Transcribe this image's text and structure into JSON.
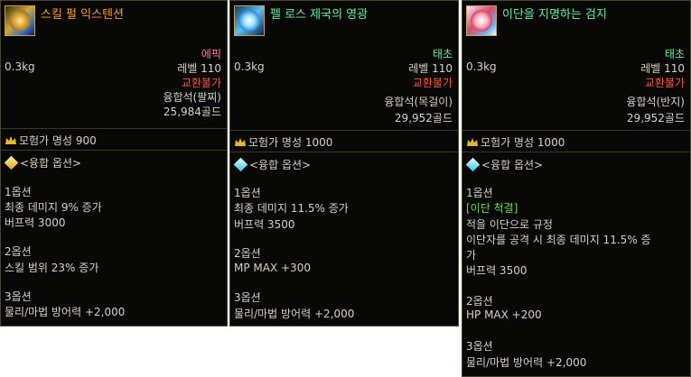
{
  "tooltips": [
    {
      "title": "스킬 펄 익스텐션",
      "rarity": "에픽",
      "weight": "0.3kg",
      "level": "레벨 110",
      "trade": "교환불가",
      "stone": "융합석(팔찌)",
      "price": "25,984골드",
      "fame": "모험가 명성 900",
      "fusion_header": "<융합 옵션>",
      "opt1_label": "1옵션",
      "opt1_line1": "최종 데미지 9% 증가",
      "opt1_line2": "버프력 3000",
      "opt2_label": "2옵션",
      "opt2_line1": "스킬 범위 23% 증가",
      "opt3_label": "3옵션",
      "opt3_line1": "물리/마법 방어력 +2,000"
    },
    {
      "title": "펠 로스 제국의 영광",
      "rarity": "태초",
      "weight": "0.3kg",
      "level": "레벨 110",
      "trade": "교환불가",
      "stone": "융합석(목걸이)",
      "price": "29,952골드",
      "fame": "모험가 명성 1000",
      "fusion_header": "<융합 옵션>",
      "opt1_label": "1옵션",
      "opt1_line1": "최종 데미지 11.5% 증가",
      "opt1_line2": "버프력 3500",
      "opt2_label": "2옵션",
      "opt2_line1": "MP MAX +300",
      "opt3_label": "3옵션",
      "opt3_line1": "물리/마법 방어력 +2,000"
    },
    {
      "title": "이단을 지명하는 검지",
      "rarity": "태초",
      "weight": "0.3kg",
      "level": "레벨 110",
      "trade": "교환불가",
      "stone": "융합석(반지)",
      "price": "29,952골드",
      "fame": "모험가 명성 1000",
      "fusion_header": "<융합 옵션>",
      "opt1_label": "1옵션",
      "opt1_tag": "[이단 척결]",
      "opt1_line1": "적을 이단으로 규정",
      "opt1_line2": "이단자를 공격 시 최종 데미지 11.5% 증",
      "opt1_line3": "가",
      "opt1_line4": "버프력 3500",
      "opt2_label": "2옵션",
      "opt2_line1": "HP MAX +200",
      "opt3_label": "3옵션",
      "opt3_line1": "물리/마법 방어력 +2,000"
    }
  ],
  "colors": {
    "epic": "#ff7fa6",
    "primeval": "#68f0a0",
    "untradeable": "#ff5a40",
    "text": "#d7d2c4"
  },
  "icons": [
    "skill-pearl-bracelet-icon",
    "fell-ros-necklace-icon",
    "heresy-ring-icon",
    "adventurer-fame-icon",
    "fusion-option-icon"
  ]
}
